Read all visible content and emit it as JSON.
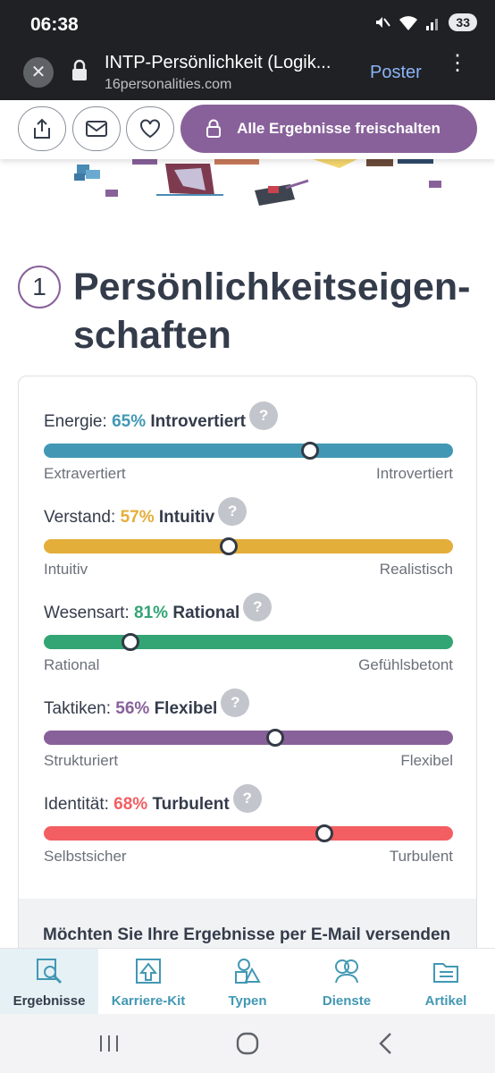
{
  "status_bar": {
    "time": "06:38",
    "battery": "33"
  },
  "browser": {
    "tab_title": "INTP-Persönlichkeit (Logik...",
    "domain": "16personalities.com",
    "poster_label": "Poster"
  },
  "actions": {
    "unlock_label": "Alle Ergebnisse freischalten"
  },
  "section": {
    "number": "1",
    "title": "Persönlichkeitseigen-schaften"
  },
  "traits": [
    {
      "label": "Energie:",
      "percent": "65%",
      "name": "Introvertiert",
      "left_pole": "Extravertiert",
      "right_pole": "Introvertiert",
      "color": "#4298b4",
      "position": 0.65
    },
    {
      "label": "Verstand:",
      "percent": "57%",
      "name": "Intuitiv",
      "left_pole": "Intuitiv",
      "right_pole": "Realistisch",
      "color": "#e4ae3a",
      "position": 0.453
    },
    {
      "label": "Wesensart:",
      "percent": "81%",
      "name": "Rational",
      "left_pole": "Rational",
      "right_pole": "Gefühlsbetont",
      "color": "#33a474",
      "position": 0.211
    },
    {
      "label": "Taktiken:",
      "percent": "56%",
      "name": "Flexibel",
      "left_pole": "Strukturiert",
      "right_pole": "Flexibel",
      "color": "#88619a",
      "position": 0.565
    },
    {
      "label": "Identität:",
      "percent": "68%",
      "name": "Turbulent",
      "left_pole": "Selbstsicher",
      "right_pole": "Turbulent",
      "color": "#f25e62",
      "position": 0.685
    }
  ],
  "email_prompt": "Möchten Sie Ihre Ergebnisse per E-Mail versenden",
  "bottom_nav": [
    {
      "label": "Ergebnisse",
      "icon": "results-icon",
      "active": true
    },
    {
      "label": "Karriere-Kit",
      "icon": "career-kit-icon",
      "active": false
    },
    {
      "label": "Typen",
      "icon": "types-icon",
      "active": false
    },
    {
      "label": "Dienste",
      "icon": "services-icon",
      "active": false
    },
    {
      "label": "Artikel",
      "icon": "articles-icon",
      "active": false
    }
  ]
}
